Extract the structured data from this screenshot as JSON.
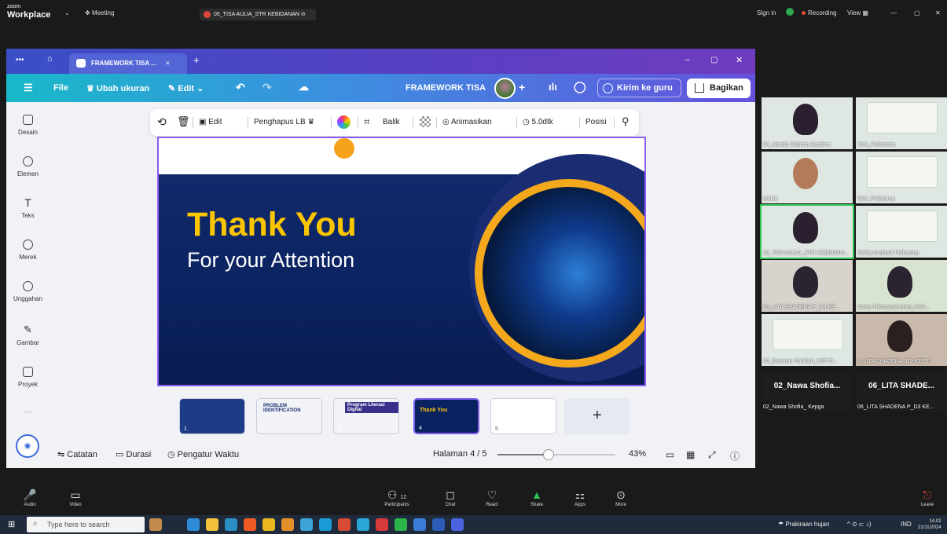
{
  "zoom_top": {
    "logo": "zoom",
    "workplace": "Workplace",
    "meeting": "Meeting",
    "share_title": "05_TISA AULIA_STR KEBIDANAN",
    "sign_in": "Sign in",
    "recording": "Recording",
    "view": "View"
  },
  "canva_tab": {
    "title": "FRAMEWORK TISA ...",
    "close": "×",
    "plus": "+"
  },
  "canva_toolbar": {
    "file": "File",
    "resize": "Ubah ukuran",
    "edit": "Edit",
    "project_title": "FRAMEWORK TISA",
    "send": "Kirim ke guru",
    "share": "Bagikan"
  },
  "sidebar": {
    "items": [
      {
        "label": "Desain"
      },
      {
        "label": "Elemen"
      },
      {
        "label": "Teks"
      },
      {
        "label": "Merek"
      },
      {
        "label": "Unggahan"
      },
      {
        "label": "Gambar"
      },
      {
        "label": "Proyek"
      }
    ]
  },
  "element_toolbar": {
    "edit": "Edit",
    "bg_remover": "Penghapus LB",
    "flip": "Balik",
    "animate": "Animasikan",
    "duration": "5.0dtk",
    "position": "Posisi"
  },
  "slide": {
    "title": "Thank You",
    "subtitle": "For your Attention"
  },
  "thumbnails": [
    {
      "num": "1",
      "caption": ""
    },
    {
      "num": "2",
      "caption": "PROBLEM IDENTIFICATION"
    },
    {
      "num": "3",
      "caption": "Program Literasi Digital"
    },
    {
      "num": "4",
      "caption": "Thank You"
    },
    {
      "num": "5",
      "caption": ""
    }
  ],
  "bottom_bar": {
    "notes": "Catatan",
    "duration": "Durasi",
    "timer": "Pengatur Waktu",
    "page": "Halaman 4 / 5",
    "zoom": "43%",
    "zoom_level": 0.43
  },
  "gallery": [
    {
      "name": "04_Nanda Sabrina Azzahra"
    },
    {
      "name": "Yeni_Polkesma"
    },
    {
      "name": "Mulito"
    },
    {
      "name": "Siwi_Polkesma"
    },
    {
      "name": "05_TISA AULIA_STR KEBIDANA..."
    },
    {
      "name": "Sisilia Andriani Polkesma"
    },
    {
      "name": "06_LITA SHADENA P_D3 KE..."
    },
    {
      "name": "Armia Hikmaturrachmi_Polk..."
    },
    {
      "name": "03_Rahman Fadillah_KEP D..."
    },
    {
      "name": "6_LITA SHADENA_D3-KEP.T..."
    },
    {
      "name": "02_Nawa Shofia...",
      "sub": "02_Nawa Shofia_ Kepga"
    },
    {
      "name": "06_LITA SHADE...",
      "sub": "06_LITA SHADENA P_D3 KE..."
    }
  ],
  "zoom_bottom": {
    "audio": "Audio",
    "video": "Video",
    "participants": "Participants",
    "participant_count": "12",
    "chat": "Chat",
    "react": "React",
    "share": "Share",
    "apps": "Apps",
    "more": "More",
    "leave": "Leave"
  },
  "taskbar": {
    "search_placeholder": "Type here to search",
    "weather": "Prakiraan hujan",
    "lang": "IND",
    "time": "14.02",
    "date": "21/11/2024"
  },
  "colors": {
    "slide_bg": "#0b2260",
    "slide_accent": "#fbc500",
    "canva_gradient_start": "#18b9c9",
    "canva_gradient_end": "#6551dc",
    "active_speaker": "#2ec455"
  }
}
